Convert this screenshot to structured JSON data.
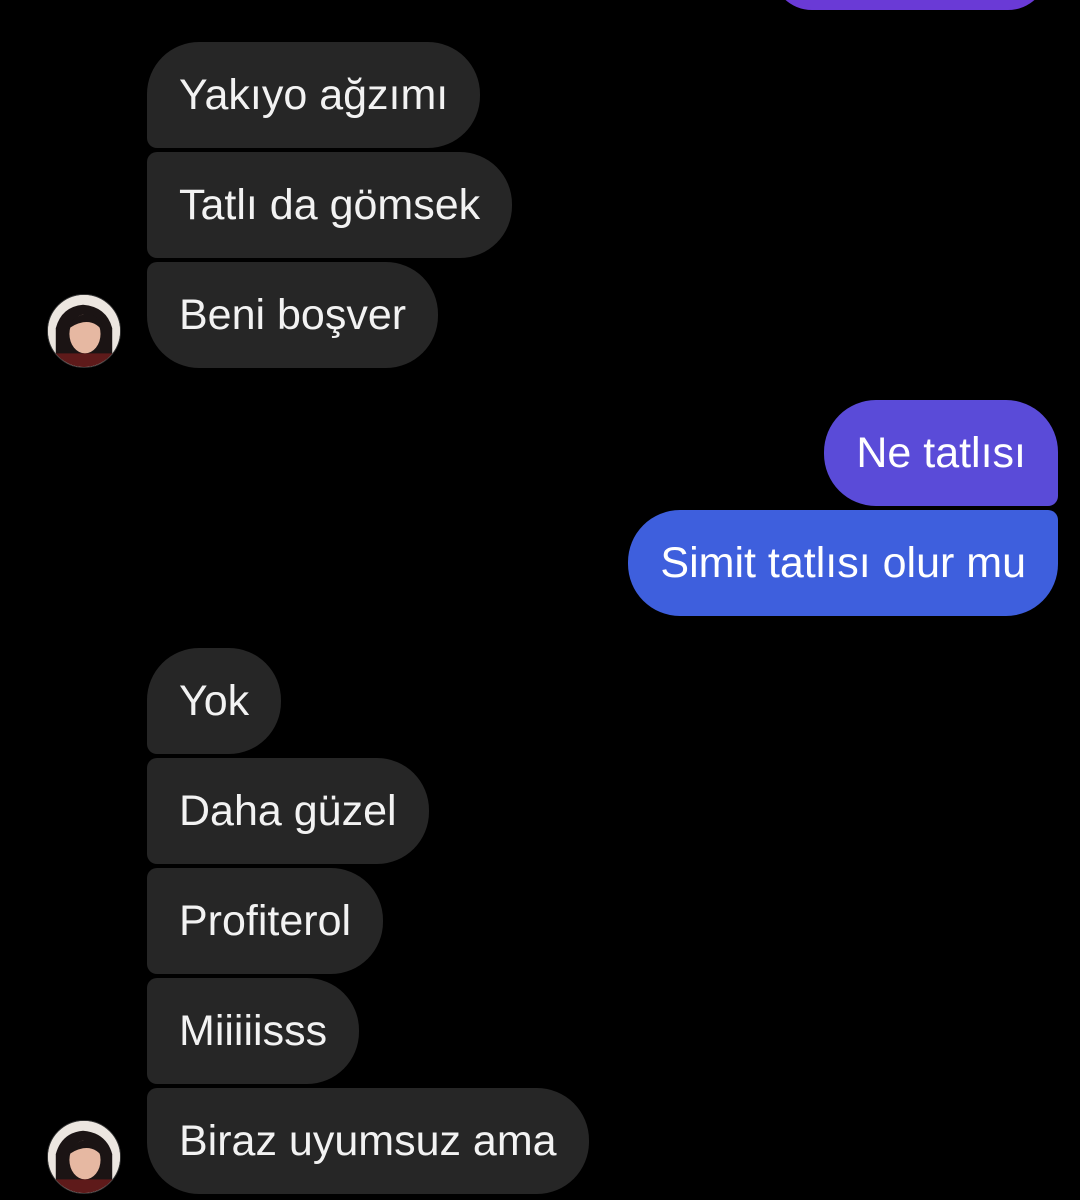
{
  "colors": {
    "background": "#000000",
    "received_bubble": "#262626",
    "sent_bubble_top": "#5a4bd8",
    "sent_bubble_bottom": "#3e5fdd",
    "text": "#f2f2f2"
  },
  "contact": {
    "avatar": "profile-photo"
  },
  "messages": {
    "group1": [
      "Yakıyo ağzımı",
      "Tatlı da gömsek",
      "Beni boşver"
    ],
    "sent": [
      "Ne tatlısı",
      "Simit tatlısı olur mu"
    ],
    "group2": [
      "Yok",
      "Daha güzel",
      "Profiterol",
      "Miiiiisss",
      "Biraz uyumsuz ama"
    ]
  }
}
